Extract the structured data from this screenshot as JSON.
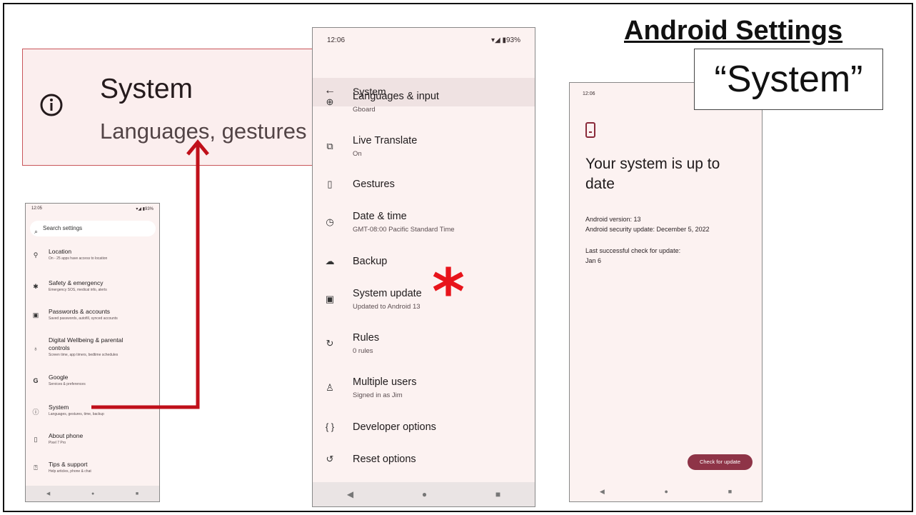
{
  "slide": {
    "title": "Android Settings",
    "label": "“System”"
  },
  "zoom": {
    "title": "System",
    "subtitle": "Languages, gestures"
  },
  "settings_phone": {
    "status_time": "12:05",
    "status_right": "▾◢ ▮93%",
    "search_placeholder": "Search settings",
    "items": [
      {
        "icon": "location-icon",
        "glyph": "⚲",
        "title": "Location",
        "sub": "On - 25 apps have access to location"
      },
      {
        "icon": "asterisk-icon",
        "glyph": "✱",
        "title": "Safety & emergency",
        "sub": "Emergency SOS, medical info, alerts"
      },
      {
        "icon": "id-card-icon",
        "glyph": "▣",
        "title": "Passwords & accounts",
        "sub": "Saved passwords, autofill, synced accounts"
      },
      {
        "icon": "wellbeing-icon",
        "glyph": "♁",
        "title": "Digital Wellbeing & parental",
        "title2": "controls",
        "sub": "Screen time, app timers, bedtime schedules"
      },
      {
        "icon": "google-icon",
        "glyph": "G",
        "title": "Google",
        "sub": "Services & preferences"
      },
      {
        "icon": "info-icon",
        "glyph": "ⓘ",
        "title": "System",
        "sub": "Languages, gestures, time, backup"
      },
      {
        "icon": "phone-icon",
        "glyph": "▯",
        "title": "About phone",
        "sub": "Pixel 7 Pro"
      },
      {
        "icon": "help-icon",
        "glyph": "?",
        "title": "Tips & support",
        "sub": "Help articles, phone & chat"
      }
    ],
    "nav": [
      "◀",
      "●",
      "■"
    ]
  },
  "system_phone": {
    "status_time": "12:06",
    "status_right": "▾◢ ▮93%",
    "header_title": "System",
    "items": [
      {
        "icon": "globe-icon",
        "glyph": "⊕",
        "title": "Languages & input",
        "sub": "Gboard"
      },
      {
        "icon": "translate-icon",
        "glyph": "⧉",
        "title": "Live Translate",
        "sub": "On"
      },
      {
        "icon": "gestures-icon",
        "glyph": "▯",
        "title": "Gestures",
        "sub": ""
      },
      {
        "icon": "clock-icon",
        "glyph": "◷",
        "title": "Date & time",
        "sub": "GMT-08:00 Pacific Standard Time"
      },
      {
        "icon": "cloud-upload-icon",
        "glyph": "☁",
        "title": "Backup",
        "sub": ""
      },
      {
        "icon": "system-update-icon",
        "glyph": "▣",
        "title": "System update",
        "sub": "Updated to Android 13"
      },
      {
        "icon": "rules-icon",
        "glyph": "↻",
        "title": "Rules",
        "sub": "0 rules"
      },
      {
        "icon": "users-icon",
        "glyph": "♙",
        "title": "Multiple users",
        "sub": "Signed in as Jim"
      },
      {
        "icon": "braces-icon",
        "glyph": "{ }",
        "title": "Developer options",
        "sub": ""
      },
      {
        "icon": "reset-icon",
        "glyph": "↺",
        "title": "Reset options",
        "sub": ""
      }
    ],
    "nav": [
      "◀",
      "●",
      "■"
    ]
  },
  "update_phone": {
    "status_time": "12:06",
    "heading": "Your system is up to date",
    "version": "Android version: 13",
    "security": "Android security update: December 5, 2022",
    "last_check_label": "Last successful check for update:",
    "last_check_date": "Jan 6",
    "button": "Check for update",
    "nav": [
      "◀",
      "●",
      "■"
    ]
  },
  "accent_colors": {
    "arrow": "#c0101a",
    "star": "#e8141b",
    "button": "#8e3447"
  }
}
